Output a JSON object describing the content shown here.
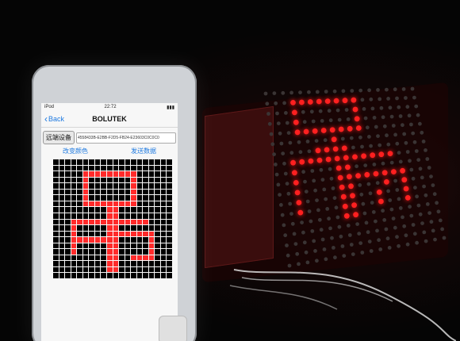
{
  "phone": {
    "status": {
      "carrier": "iPod",
      "time": "22:72",
      "battery": "▮▮▮"
    },
    "nav": {
      "back_label": "Back",
      "title": "BOLUTEK"
    },
    "remote_button": "远端设备",
    "device_uuid": "4558433B-E2BB-F2D5-FB24-E23603C0C0C0",
    "change_color_label": "改变颜色",
    "send_data_label": "发送数据",
    "matrix": {
      "rows": 20,
      "cols": 20,
      "on_color": "#ff2a2a",
      "off_color": "#000000",
      "pattern": [
        "....................",
        "....................",
        "....................",
        "........................",
        "....................",
        "....................",
        "....................",
        "....................",
        "....................",
        "....................",
        "....................",
        "....................",
        "....................",
        "....................",
        "....................",
        "....................",
        "....................",
        "....................",
        "....................",
        "...................."
      ]
    }
  },
  "led_board": {
    "rows": 16,
    "cols": 16,
    "on_color": "#ff2020"
  }
}
